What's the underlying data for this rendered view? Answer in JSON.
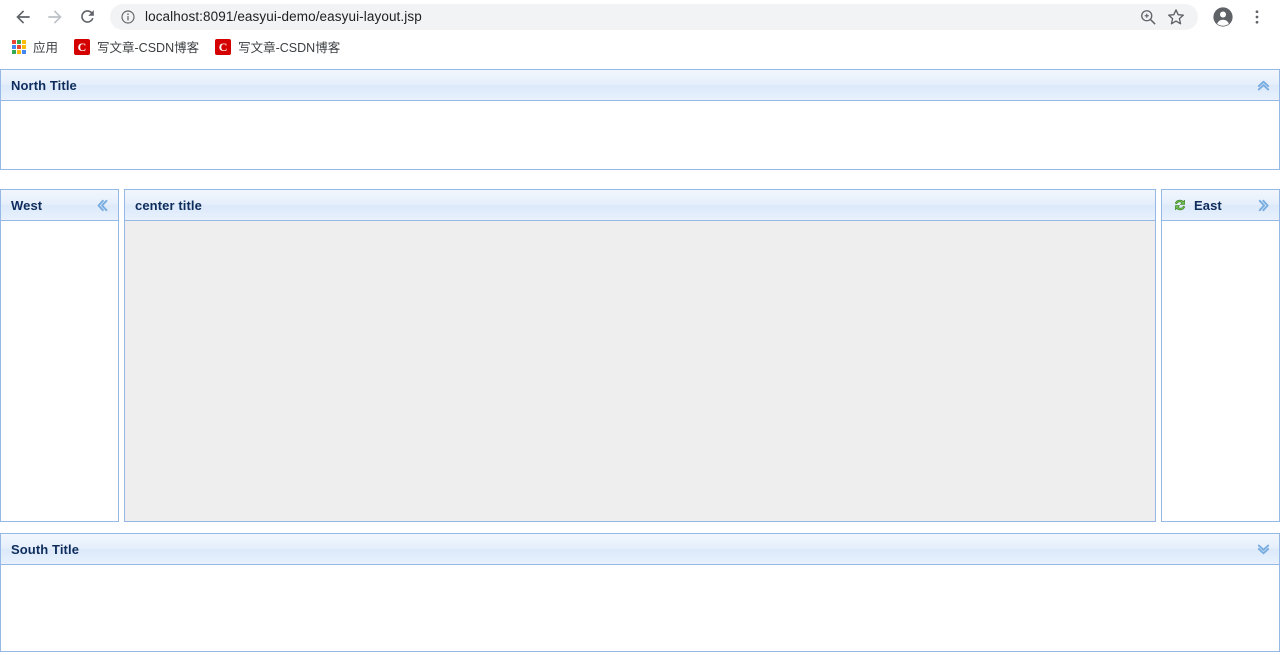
{
  "browser": {
    "back_tooltip": "Back",
    "forward_tooltip": "Forward",
    "reload_tooltip": "Reload",
    "site_info_icon": "info-circle-icon",
    "url": "localhost:8091/easyui-demo/easyui-layout.jsp",
    "url_host": "localhost:8091",
    "url_path": "/easyui-demo/easyui-layout.jsp",
    "zoom_icon": "zoom-in-icon",
    "bookmark_icon": "star-icon",
    "profile_icon": "account-avatar-icon",
    "menu_icon": "three-dot-menu-icon"
  },
  "bookmarks": {
    "apps": {
      "label": "应用",
      "icon": "apps-grid-icon"
    },
    "items": [
      {
        "label": "写文章-CSDN博客",
        "icon": "csdn-favicon",
        "glyph": "C"
      },
      {
        "label": "写文章-CSDN博客",
        "icon": "csdn-favicon",
        "glyph": "C"
      }
    ]
  },
  "layout": {
    "north": {
      "title": "North Title",
      "collapse_tool": "collapse-up-icon",
      "body_text": ""
    },
    "west": {
      "title": "West",
      "collapse_tool": "collapse-left-icon",
      "body_text": ""
    },
    "center": {
      "title": "center title",
      "body_text": ""
    },
    "east": {
      "title": "East",
      "icon": "reload-sync-icon",
      "collapse_tool": "collapse-right-icon",
      "body_text": ""
    },
    "south": {
      "title": "South Title",
      "collapse_tool": "collapse-down-icon",
      "body_text": ""
    }
  },
  "colors": {
    "header_border": "#95b8e7",
    "title_text": "#0e2d5c",
    "tool_blue": "#7aaee0",
    "center_body": "#eeeeee",
    "csdn_red": "#d40000"
  }
}
